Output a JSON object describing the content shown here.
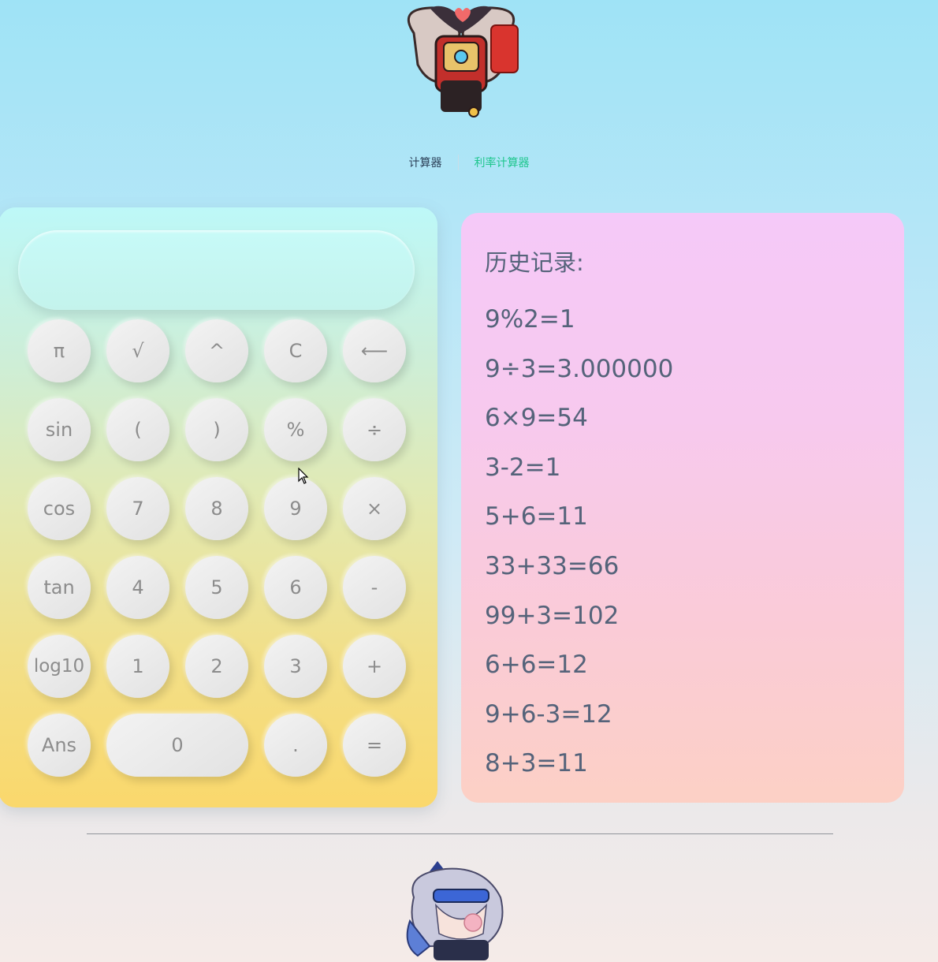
{
  "nav": {
    "calculator": "计算器",
    "rate_calculator": "利率计算器"
  },
  "calculator": {
    "display_value": "",
    "keys": [
      {
        "label": "π",
        "name": "key-pi"
      },
      {
        "label": "√",
        "name": "key-sqrt"
      },
      {
        "label": "^",
        "name": "key-power"
      },
      {
        "label": "C",
        "name": "key-clear"
      },
      {
        "label": "⟵",
        "name": "key-backspace"
      },
      {
        "label": "sin",
        "name": "key-sin"
      },
      {
        "label": "(",
        "name": "key-open-paren"
      },
      {
        "label": ")",
        "name": "key-close-paren"
      },
      {
        "label": "%",
        "name": "key-percent"
      },
      {
        "label": "÷",
        "name": "key-divide"
      },
      {
        "label": "cos",
        "name": "key-cos"
      },
      {
        "label": "7",
        "name": "key-7"
      },
      {
        "label": "8",
        "name": "key-8"
      },
      {
        "label": "9",
        "name": "key-9"
      },
      {
        "label": "×",
        "name": "key-multiply"
      },
      {
        "label": "tan",
        "name": "key-tan"
      },
      {
        "label": "4",
        "name": "key-4"
      },
      {
        "label": "5",
        "name": "key-5"
      },
      {
        "label": "6",
        "name": "key-6"
      },
      {
        "label": "-",
        "name": "key-minus"
      },
      {
        "label": "log10",
        "name": "key-log10"
      },
      {
        "label": "1",
        "name": "key-1"
      },
      {
        "label": "2",
        "name": "key-2"
      },
      {
        "label": "3",
        "name": "key-3"
      },
      {
        "label": "+",
        "name": "key-plus"
      },
      {
        "label": "Ans",
        "name": "key-ans"
      },
      {
        "label": "0",
        "name": "key-0"
      },
      {
        "label": ".",
        "name": "key-decimal"
      },
      {
        "label": "=",
        "name": "key-equals"
      }
    ]
  },
  "history": {
    "title": "历史记录:",
    "items": [
      "9%2=1",
      "9÷3=3.000000",
      "6×9=54",
      "3-2=1",
      "5+6=11",
      "33+33=66",
      "99+3=102",
      "6+6=12",
      "9+6-3=12",
      "8+3=11"
    ]
  },
  "colors": {
    "nav_active": "#1fc68e",
    "nav_default": "#2b3f57",
    "history_text": "#55637a",
    "key_text": "#8c8c8c"
  },
  "icons": {
    "top_mascot": "chibi-character-red-robe-icon",
    "bottom_mascot": "chibi-character-silver-hair-icon"
  }
}
